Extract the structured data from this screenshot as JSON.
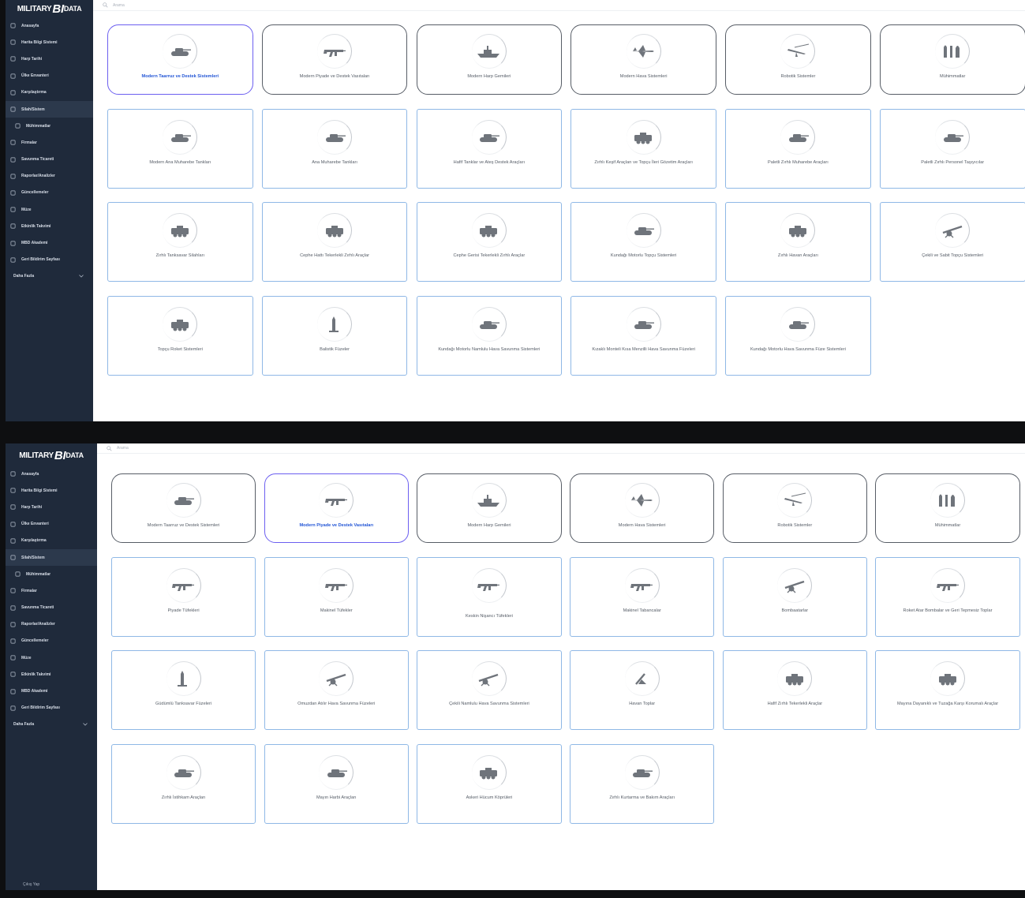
{
  "app": {
    "logo_main": "MILITARY",
    "logo_accent": "BI",
    "logo_tail": "DATA"
  },
  "colors": {
    "sidebar_bg": "#1f2a3b",
    "selected_border": "#6c5ff0",
    "selected_text": "#2356d6",
    "card_border": "#8fb8e6"
  },
  "search": {
    "placeholder": "Arama"
  },
  "sidebar": {
    "items": [
      {
        "label": "Anasayfa",
        "icon": "home-icon"
      },
      {
        "label": "Harita Bilgi Sistemi",
        "icon": "globe-icon"
      },
      {
        "label": "Harp Tarihi",
        "icon": "map-icon"
      },
      {
        "label": "Ülke Envanteri",
        "icon": "flag-icon"
      },
      {
        "label": "Karşılaştırma",
        "icon": "chart-line-icon"
      },
      {
        "label": "Silah/Sistem",
        "icon": "shield-icon"
      },
      {
        "label": "Mühimmatlar",
        "icon": "bullet-icon"
      },
      {
        "label": "Firmalar",
        "icon": "factory-icon"
      },
      {
        "label": "Savunma Ticareti",
        "icon": "trade-icon"
      },
      {
        "label": "Raporlar/Analizler",
        "icon": "report-icon"
      },
      {
        "label": "Güncellemeler",
        "icon": "refresh-icon"
      },
      {
        "label": "Müze",
        "icon": "museum-icon"
      },
      {
        "label": "Etkinlik Takvimi",
        "icon": "calendar-icon"
      },
      {
        "label": "MBD Akademi",
        "icon": "academy-icon"
      },
      {
        "label": "Geri Bildirim Sayfası",
        "icon": "feedback-icon"
      }
    ],
    "more": "Daha Fazla",
    "footer": "Çıkış Yap"
  },
  "categories": [
    {
      "label": "Modern Taarruz ve Destek Sistemleri",
      "icon": "tank-icon"
    },
    {
      "label": "Modern Piyade ve Destek Vasıtaları",
      "icon": "rifle-icon"
    },
    {
      "label": "Modern Harp Gemileri",
      "icon": "warship-icon"
    },
    {
      "label": "Modern Hava Sistemleri",
      "icon": "fighter-jet-icon"
    },
    {
      "label": "Robotik Sistemler",
      "icon": "drone-icon"
    },
    {
      "label": "Mühimmatlar",
      "icon": "ammunition-icon"
    }
  ],
  "screen1": {
    "selected_index": 0,
    "items": [
      {
        "label": "Modern Ana Muharebe Tankları",
        "icon": "tank-icon"
      },
      {
        "label": "Ana Muharebe Tankları",
        "icon": "tank-icon"
      },
      {
        "label": "Hafif Tanklar ve Ateş Destek Araçları",
        "icon": "light-tank-icon"
      },
      {
        "label": "Zırhlı Keşif Araçları ve Topçu İleri Gözetim Araçları",
        "icon": "recon-vehicle-icon"
      },
      {
        "label": "Paletli Zırhlı Muharebe Araçları",
        "icon": "ifv-icon"
      },
      {
        "label": "Paletli Zırhlı Personel Taşıyıcılar",
        "icon": "apc-icon"
      },
      {
        "label": "Zırhlı Tanksavar Silahları",
        "icon": "antitank-vehicle-icon"
      },
      {
        "label": "Cephe Hattı Tekerlekli Zırhlı Araçlar",
        "icon": "wheeled-vehicle-icon"
      },
      {
        "label": "Cephe Gerisi Tekerlekli Zırhlı Araçlar",
        "icon": "wheeled-vehicle-icon"
      },
      {
        "label": "Kundağı Motorlu Topçu Sistemleri",
        "icon": "howitzer-icon"
      },
      {
        "label": "Zırhlı Havan Araçları",
        "icon": "mortar-vehicle-icon"
      },
      {
        "label": "Çekili ve Sabit Topçu Sistemleri",
        "icon": "towed-gun-icon"
      },
      {
        "label": "Topçu Roket Sistemleri",
        "icon": "rocket-launcher-icon"
      },
      {
        "label": "Balistik Füzeler",
        "icon": "ballistic-missile-icon"
      },
      {
        "label": "Kundağı Motorlu Namlulu Hava Savunma Sistemleri",
        "icon": "aa-gun-vehicle-icon"
      },
      {
        "label": "Kızaklı Monteli Kısa Menzilli Hava Savunma Füzeleri",
        "icon": "sam-vehicle-icon"
      },
      {
        "label": "Kundağı Motorlu Hava Savunma Füze Sistemleri",
        "icon": "sam-vehicle-icon"
      }
    ]
  },
  "screen2": {
    "selected_index": 1,
    "items": [
      {
        "label": "Piyade Tüfekleri",
        "icon": "rifle-icon"
      },
      {
        "label": "Makinel Tüfekler",
        "icon": "machine-gun-icon"
      },
      {
        "label": "Keskin Nişancı Tüfekleri",
        "icon": "sniper-rifle-icon"
      },
      {
        "label": "Makinel Tabancalar",
        "icon": "smg-icon"
      },
      {
        "label": "Bombaatarlar",
        "icon": "grenade-launcher-icon"
      },
      {
        "label": "Roket Atar Bombalar ve Geri Tepmesiz Toplar",
        "icon": "rpg-icon"
      },
      {
        "label": "Güdümlü Tanksavar Füzeleri",
        "icon": "atgm-icon"
      },
      {
        "label": "Omuzdan Atılır Hava Savunma Füzeleri",
        "icon": "manpads-icon"
      },
      {
        "label": "Çekili Namlulu Hava Savunma Sistemleri",
        "icon": "towed-aa-gun-icon"
      },
      {
        "label": "Havan Toplar",
        "icon": "mortar-icon"
      },
      {
        "label": "Hafif Zırhlı Tekerlekli Araçlar",
        "icon": "light-armored-vehicle-icon"
      },
      {
        "label": "Mayına Dayanıklı ve Tuzağa Karşı Korumalı Araçlar",
        "icon": "mrap-icon"
      },
      {
        "label": "Zırhlı İstihkam Araçları",
        "icon": "engineering-vehicle-icon"
      },
      {
        "label": "Mayın Harbi Araçları",
        "icon": "mine-clearing-icon"
      },
      {
        "label": "Askeri Hücum Köprüleri",
        "icon": "bridge-layer-icon"
      },
      {
        "label": "Zırhlı Kurtarma ve Bakım Araçları",
        "icon": "recovery-vehicle-icon"
      }
    ]
  }
}
